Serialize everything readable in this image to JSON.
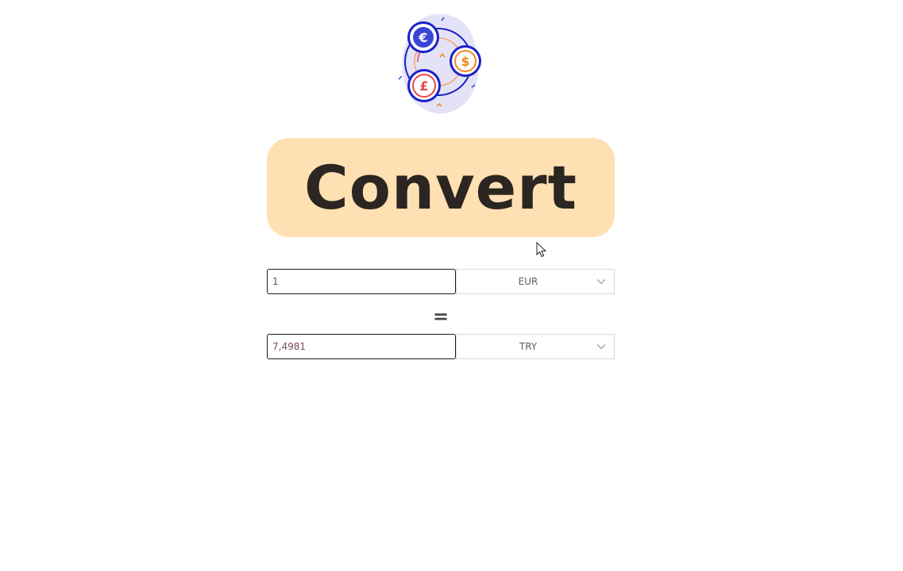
{
  "convert_button": {
    "label": "Convert",
    "background": "#ffe0b2"
  },
  "from": {
    "amount": "1",
    "currency": "EUR"
  },
  "equals_sign": "=",
  "to": {
    "amount": "7,4981",
    "currency": "TRY"
  },
  "logo": {
    "icon": "currency-exchange-icon",
    "coins": [
      "€",
      "$",
      "£"
    ],
    "colors": {
      "euro": "#3b46d6",
      "dollar": "#f08a1c",
      "pound": "#e8484a",
      "ring": "#1a20c8",
      "blob": "#e4e2f7"
    }
  }
}
